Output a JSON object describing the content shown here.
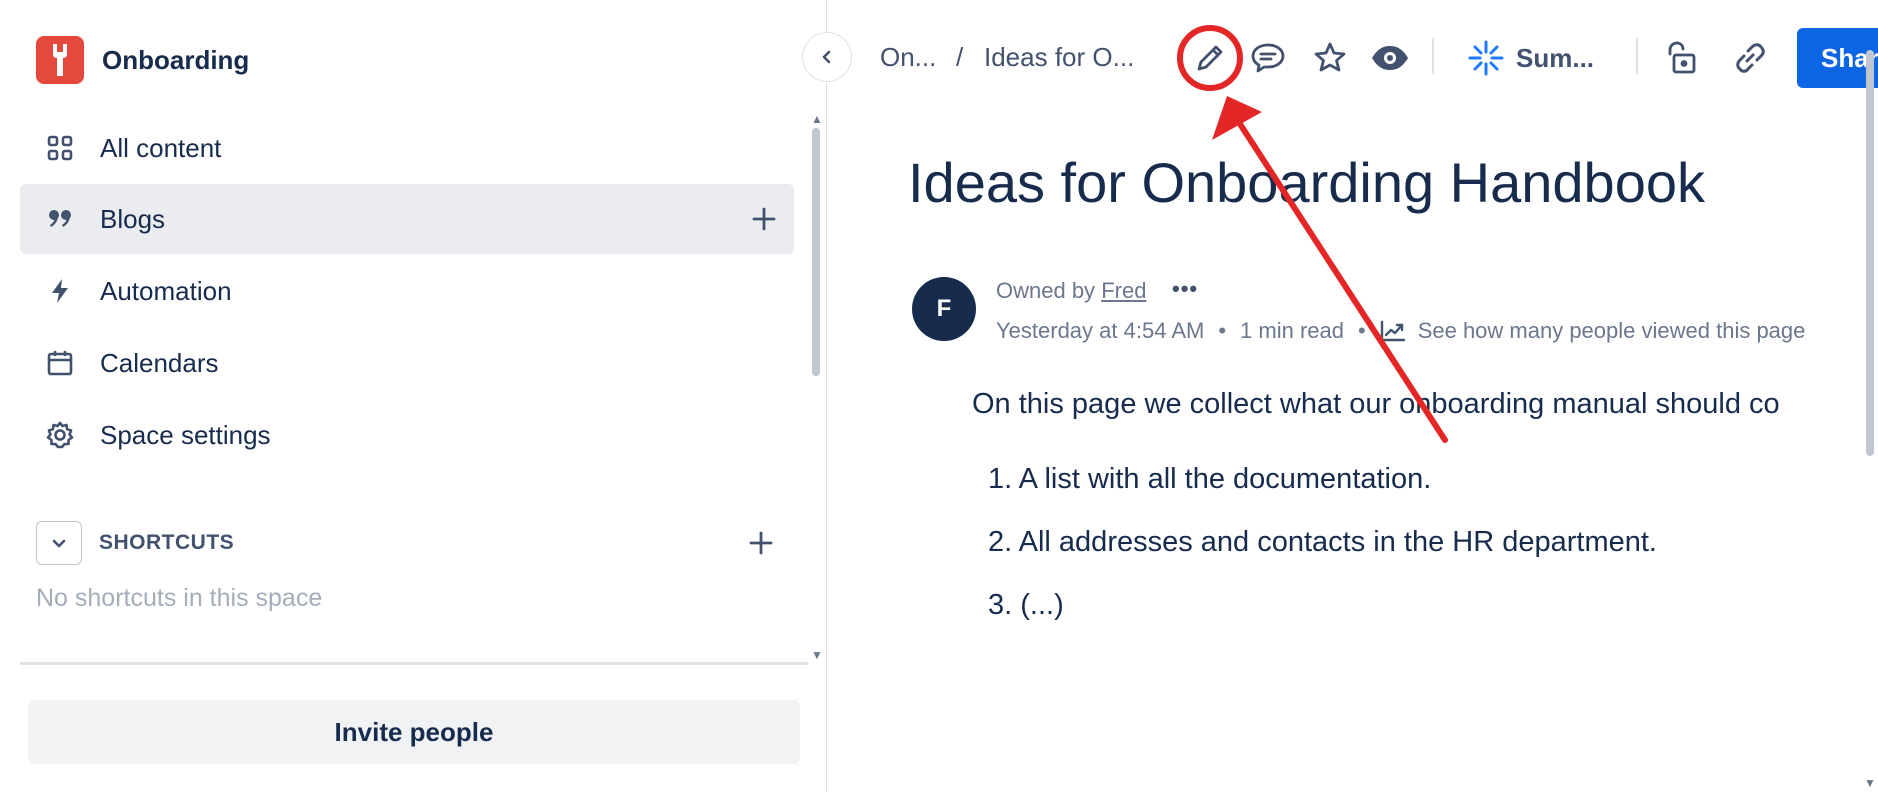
{
  "sidebar": {
    "space_name": "Onboarding",
    "items": [
      {
        "label": "All content",
        "icon": "grid-icon"
      },
      {
        "label": "Blogs",
        "icon": "quote-icon"
      },
      {
        "label": "Automation",
        "icon": "lightning-icon"
      },
      {
        "label": "Calendars",
        "icon": "calendar-icon"
      },
      {
        "label": "Space settings",
        "icon": "gear-icon"
      }
    ],
    "shortcuts_label": "SHORTCUTS",
    "no_shortcuts": "No shortcuts in this space",
    "invite_label": "Invite people"
  },
  "breadcrumb": {
    "items": [
      "On...",
      "Ideas for O..."
    ],
    "separator": "/"
  },
  "toolbar": {
    "summarize_label": "Sum...",
    "share_label": "Share"
  },
  "page": {
    "title": "Ideas for Onboarding Handbook",
    "avatar_initial": "F",
    "owned_by": "Owned by",
    "owner": "Fred",
    "timestamp": "Yesterday at 4:54 AM",
    "read_time": "1 min read",
    "analytics_link": "See how many people viewed this page",
    "intro": "On this page we collect what our onboarding manual should co",
    "list": [
      "1. A list with all the documentation.",
      "2. All addresses and contacts in the HR department.",
      "3. (...)"
    ]
  },
  "colors": {
    "accent": "#0c66e4",
    "space_logo": "#e5483d",
    "annotation": "#e32626",
    "text": "#172b4d"
  }
}
